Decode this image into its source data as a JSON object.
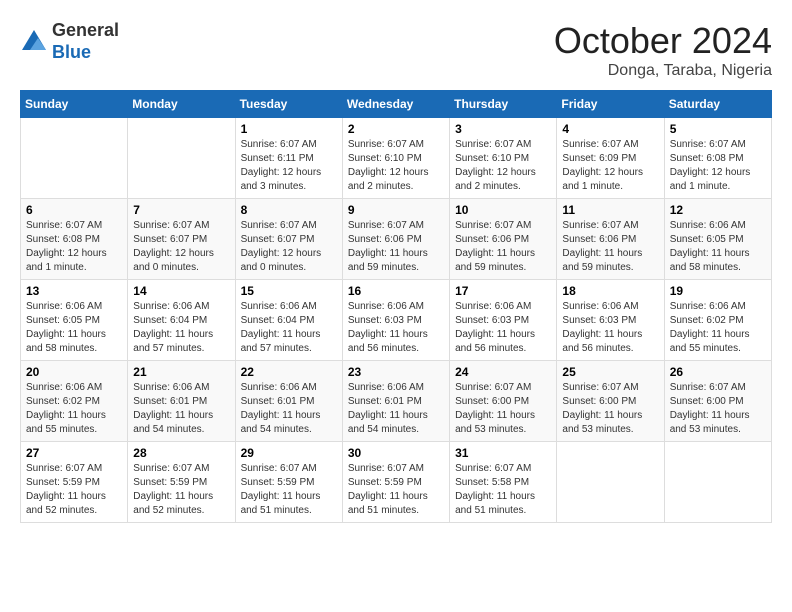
{
  "logo": {
    "general": "General",
    "blue": "Blue"
  },
  "title": "October 2024",
  "location": "Donga, Taraba, Nigeria",
  "days_of_week": [
    "Sunday",
    "Monday",
    "Tuesday",
    "Wednesday",
    "Thursday",
    "Friday",
    "Saturday"
  ],
  "weeks": [
    [
      {
        "day": "",
        "content": ""
      },
      {
        "day": "",
        "content": ""
      },
      {
        "day": "1",
        "content": "Sunrise: 6:07 AM\nSunset: 6:11 PM\nDaylight: 12 hours and 3 minutes."
      },
      {
        "day": "2",
        "content": "Sunrise: 6:07 AM\nSunset: 6:10 PM\nDaylight: 12 hours and 2 minutes."
      },
      {
        "day": "3",
        "content": "Sunrise: 6:07 AM\nSunset: 6:10 PM\nDaylight: 12 hours and 2 minutes."
      },
      {
        "day": "4",
        "content": "Sunrise: 6:07 AM\nSunset: 6:09 PM\nDaylight: 12 hours and 1 minute."
      },
      {
        "day": "5",
        "content": "Sunrise: 6:07 AM\nSunset: 6:08 PM\nDaylight: 12 hours and 1 minute."
      }
    ],
    [
      {
        "day": "6",
        "content": "Sunrise: 6:07 AM\nSunset: 6:08 PM\nDaylight: 12 hours and 1 minute."
      },
      {
        "day": "7",
        "content": "Sunrise: 6:07 AM\nSunset: 6:07 PM\nDaylight: 12 hours and 0 minutes."
      },
      {
        "day": "8",
        "content": "Sunrise: 6:07 AM\nSunset: 6:07 PM\nDaylight: 12 hours and 0 minutes."
      },
      {
        "day": "9",
        "content": "Sunrise: 6:07 AM\nSunset: 6:06 PM\nDaylight: 11 hours and 59 minutes."
      },
      {
        "day": "10",
        "content": "Sunrise: 6:07 AM\nSunset: 6:06 PM\nDaylight: 11 hours and 59 minutes."
      },
      {
        "day": "11",
        "content": "Sunrise: 6:07 AM\nSunset: 6:06 PM\nDaylight: 11 hours and 59 minutes."
      },
      {
        "day": "12",
        "content": "Sunrise: 6:06 AM\nSunset: 6:05 PM\nDaylight: 11 hours and 58 minutes."
      }
    ],
    [
      {
        "day": "13",
        "content": "Sunrise: 6:06 AM\nSunset: 6:05 PM\nDaylight: 11 hours and 58 minutes."
      },
      {
        "day": "14",
        "content": "Sunrise: 6:06 AM\nSunset: 6:04 PM\nDaylight: 11 hours and 57 minutes."
      },
      {
        "day": "15",
        "content": "Sunrise: 6:06 AM\nSunset: 6:04 PM\nDaylight: 11 hours and 57 minutes."
      },
      {
        "day": "16",
        "content": "Sunrise: 6:06 AM\nSunset: 6:03 PM\nDaylight: 11 hours and 56 minutes."
      },
      {
        "day": "17",
        "content": "Sunrise: 6:06 AM\nSunset: 6:03 PM\nDaylight: 11 hours and 56 minutes."
      },
      {
        "day": "18",
        "content": "Sunrise: 6:06 AM\nSunset: 6:03 PM\nDaylight: 11 hours and 56 minutes."
      },
      {
        "day": "19",
        "content": "Sunrise: 6:06 AM\nSunset: 6:02 PM\nDaylight: 11 hours and 55 minutes."
      }
    ],
    [
      {
        "day": "20",
        "content": "Sunrise: 6:06 AM\nSunset: 6:02 PM\nDaylight: 11 hours and 55 minutes."
      },
      {
        "day": "21",
        "content": "Sunrise: 6:06 AM\nSunset: 6:01 PM\nDaylight: 11 hours and 54 minutes."
      },
      {
        "day": "22",
        "content": "Sunrise: 6:06 AM\nSunset: 6:01 PM\nDaylight: 11 hours and 54 minutes."
      },
      {
        "day": "23",
        "content": "Sunrise: 6:06 AM\nSunset: 6:01 PM\nDaylight: 11 hours and 54 minutes."
      },
      {
        "day": "24",
        "content": "Sunrise: 6:07 AM\nSunset: 6:00 PM\nDaylight: 11 hours and 53 minutes."
      },
      {
        "day": "25",
        "content": "Sunrise: 6:07 AM\nSunset: 6:00 PM\nDaylight: 11 hours and 53 minutes."
      },
      {
        "day": "26",
        "content": "Sunrise: 6:07 AM\nSunset: 6:00 PM\nDaylight: 11 hours and 53 minutes."
      }
    ],
    [
      {
        "day": "27",
        "content": "Sunrise: 6:07 AM\nSunset: 5:59 PM\nDaylight: 11 hours and 52 minutes."
      },
      {
        "day": "28",
        "content": "Sunrise: 6:07 AM\nSunset: 5:59 PM\nDaylight: 11 hours and 52 minutes."
      },
      {
        "day": "29",
        "content": "Sunrise: 6:07 AM\nSunset: 5:59 PM\nDaylight: 11 hours and 51 minutes."
      },
      {
        "day": "30",
        "content": "Sunrise: 6:07 AM\nSunset: 5:59 PM\nDaylight: 11 hours and 51 minutes."
      },
      {
        "day": "31",
        "content": "Sunrise: 6:07 AM\nSunset: 5:58 PM\nDaylight: 11 hours and 51 minutes."
      },
      {
        "day": "",
        "content": ""
      },
      {
        "day": "",
        "content": ""
      }
    ]
  ]
}
